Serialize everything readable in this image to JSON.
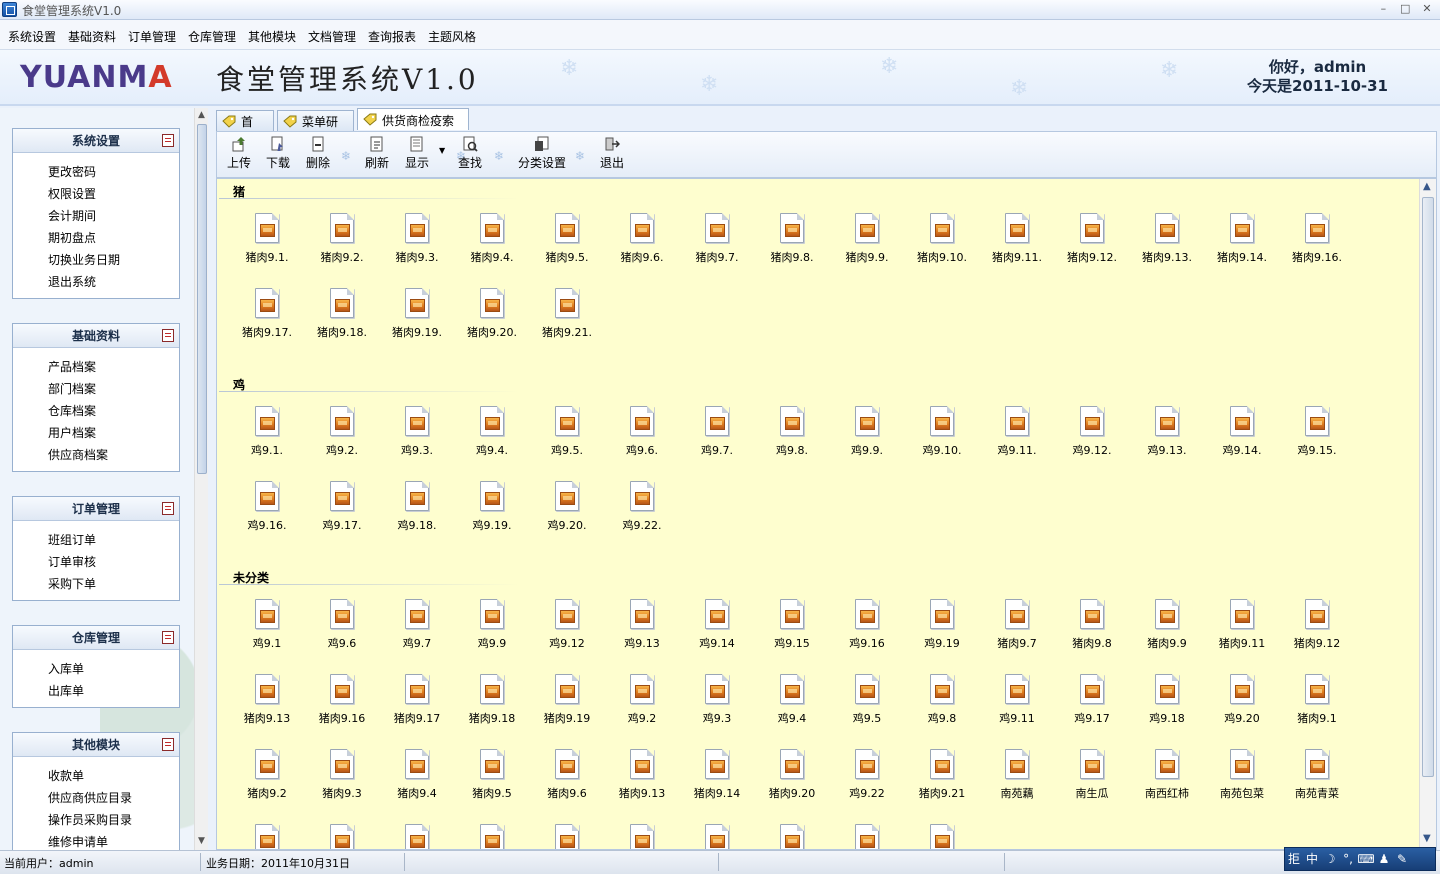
{
  "window": {
    "title": "食堂管理系统V1.0",
    "min": "–",
    "max": "□",
    "close": "✕"
  },
  "menu": [
    "系统设置",
    "基础资料",
    "订单管理",
    "仓库管理",
    "其他模块",
    "文档管理",
    "查询报表",
    "主题风格"
  ],
  "header": {
    "logo_main": "YUANM",
    "logo_accent": "A",
    "app_name": "食堂管理系统V1.0",
    "greeting": "你好，admin",
    "date_line": "今天是2011-10-31"
  },
  "sidebar": [
    {
      "title": "系统设置",
      "items": [
        "更改密码",
        "权限设置",
        "会计期间",
        "期初盘点",
        "切换业务日期",
        "退出系统"
      ]
    },
    {
      "title": "基础资料",
      "items": [
        "产品档案",
        "部门档案",
        "仓库档案",
        "用户档案",
        "供应商档案"
      ]
    },
    {
      "title": "订单管理",
      "items": [
        "班组订单",
        "订单审核",
        "采购下单"
      ]
    },
    {
      "title": "仓库管理",
      "items": [
        "入库单",
        "出库单"
      ]
    },
    {
      "title": "其他模块",
      "items": [
        "收款单",
        "供应商供应目录",
        "操作员采购目录",
        "维修申请单"
      ]
    }
  ],
  "tabs": [
    "首 页",
    "菜单研发",
    "供货商检疫索证"
  ],
  "toolbar": {
    "upload": "上传",
    "download": "下载",
    "delete": "删除",
    "refresh": "刷新",
    "display": "显示",
    "find": "查找",
    "category_settings": "分类设置",
    "exit": "退出",
    "separator_glyph": "❄"
  },
  "groups": [
    {
      "name": "猪",
      "files": [
        "猪肉9.1.",
        "猪肉9.2.",
        "猪肉9.3.",
        "猪肉9.4.",
        "猪肉9.5.",
        "猪肉9.6.",
        "猪肉9.7.",
        "猪肉9.8.",
        "猪肉9.9.",
        "猪肉9.10.",
        "猪肉9.11.",
        "猪肉9.12.",
        "猪肉9.13.",
        "猪肉9.14.",
        "猪肉9.16.",
        "猪肉9.17.",
        "猪肉9.18.",
        "猪肉9.19.",
        "猪肉9.20.",
        "猪肉9.21."
      ]
    },
    {
      "name": "鸡",
      "files": [
        "鸡9.1.",
        "鸡9.2.",
        "鸡9.3.",
        "鸡9.4.",
        "鸡9.5.",
        "鸡9.6.",
        "鸡9.7.",
        "鸡9.8.",
        "鸡9.9.",
        "鸡9.10.",
        "鸡9.11.",
        "鸡9.12.",
        "鸡9.13.",
        "鸡9.14.",
        "鸡9.15.",
        "鸡9.16.",
        "鸡9.17.",
        "鸡9.18.",
        "鸡9.19.",
        "鸡9.20.",
        "鸡9.22."
      ]
    },
    {
      "name": "未分类",
      "files": [
        "鸡9.1",
        "鸡9.6",
        "鸡9.7",
        "鸡9.9",
        "鸡9.12",
        "鸡9.13",
        "鸡9.14",
        "鸡9.15",
        "鸡9.16",
        "鸡9.19",
        "猪肉9.7",
        "猪肉9.8",
        "猪肉9.9",
        "猪肉9.11",
        "猪肉9.12",
        "猪肉9.13",
        "猪肉9.16",
        "猪肉9.17",
        "猪肉9.18",
        "猪肉9.19",
        "鸡9.2",
        "鸡9.3",
        "鸡9.4",
        "鸡9.5",
        "鸡9.8",
        "鸡9.11",
        "鸡9.17",
        "鸡9.18",
        "鸡9.20",
        "猪肉9.1",
        "猪肉9.2",
        "猪肉9.3",
        "猪肉9.4",
        "猪肉9.5",
        "猪肉9.6",
        "猪肉9.13",
        "猪肉9.14",
        "猪肉9.20",
        "鸡9.22",
        "猪肉9.21",
        "南苑藕",
        "南生瓜",
        "南西红柿",
        "南苑包菜",
        "南苑青菜",
        "",
        "",
        "",
        "",
        "",
        "",
        "",
        "",
        "",
        ""
      ]
    }
  ],
  "status": {
    "current_user": "当前用户：admin",
    "business_date": "业务日期：2011年10月31日"
  },
  "ime": [
    "拒",
    "中",
    "☽",
    "°,",
    "⌨",
    "♟",
    "✎"
  ],
  "colors": {
    "content_bg": "#fefecf",
    "accent": "#d33a2a",
    "logo": "#4a3a8a"
  }
}
